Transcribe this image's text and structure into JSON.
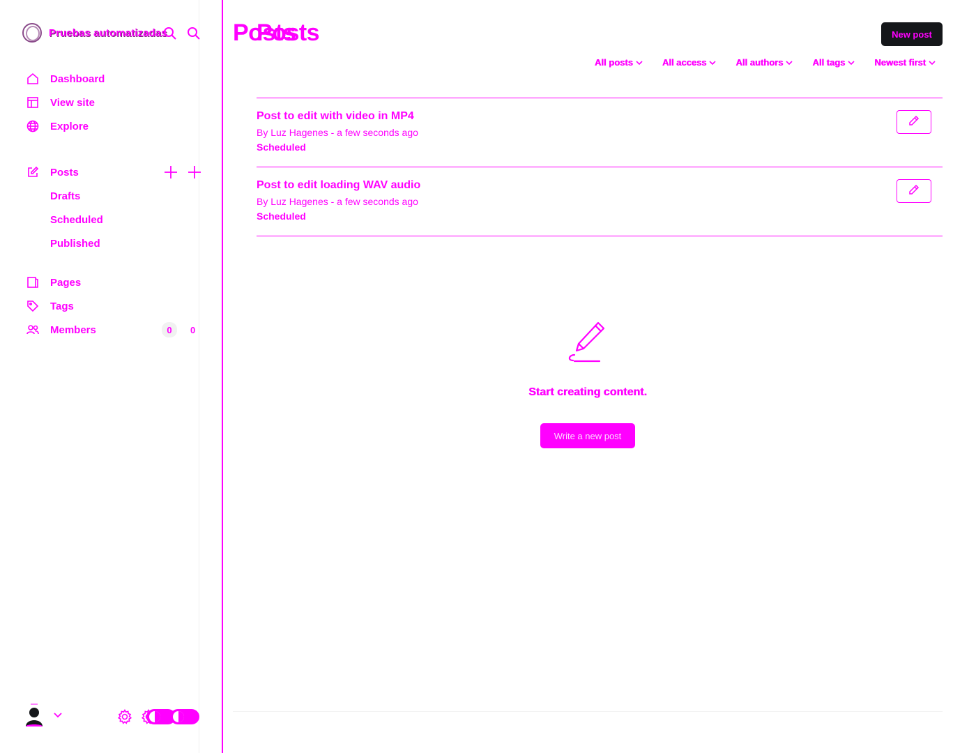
{
  "sidebar": {
    "site_title": "Pruebas automatizadas",
    "nav": {
      "dashboard": "Dashboard",
      "view_site": "View site",
      "explore": "Explore",
      "posts": "Posts",
      "drafts": "Drafts",
      "scheduled": "Scheduled",
      "published": "Published",
      "pages": "Pages",
      "tags": "Tags",
      "members": "Members",
      "members_count": "0"
    }
  },
  "header": {
    "title": "Posts",
    "new_post_label": "New post"
  },
  "filters": [
    "All posts",
    "All access",
    "All authors",
    "All tags",
    "Newest first"
  ],
  "posts": [
    {
      "title": "Post to edit with video in MP4",
      "meta": "By Luz Hagenes - a few seconds ago",
      "status": "Scheduled"
    },
    {
      "title": "Post to edit loading WAV audio",
      "meta": "By Luz Hagenes - a few seconds ago",
      "status": "Scheduled"
    }
  ],
  "empty_state": {
    "message": "Start creating content.",
    "button_label": "Write a new post"
  },
  "colors": {
    "accent": "#ff00ff",
    "dark_button": "#15171a"
  }
}
